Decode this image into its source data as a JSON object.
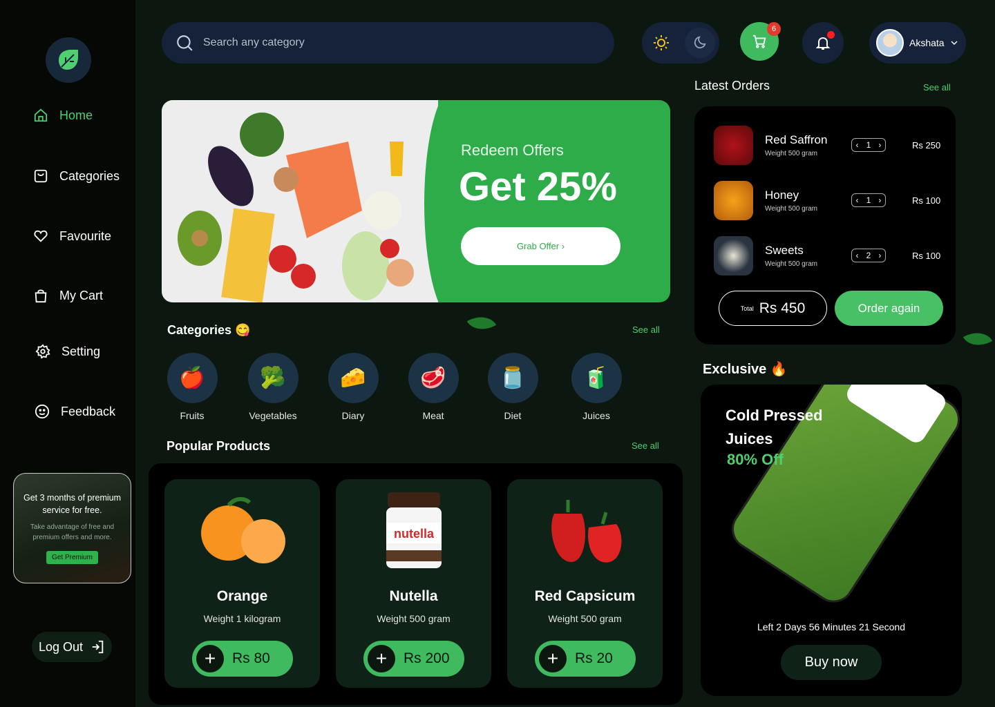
{
  "nav": {
    "items": [
      {
        "label": "Home",
        "icon": "home-icon"
      },
      {
        "label": "Categories",
        "icon": "categories-icon"
      },
      {
        "label": "Favourite",
        "icon": "heart-icon"
      },
      {
        "label": "My Cart",
        "icon": "shopping-bag-icon"
      },
      {
        "label": "Setting",
        "icon": "gear-icon"
      },
      {
        "label": "Feedback",
        "icon": "smiley-icon"
      }
    ],
    "active": "Home"
  },
  "premium": {
    "title": "Get 3 months of premium service for free.",
    "subtitle": "Take advantage of free and premium offers  and more.",
    "button": "Get Premium"
  },
  "logout": {
    "label": "Log Out"
  },
  "search": {
    "placeholder": "Search any category"
  },
  "header": {
    "cart_count": "6",
    "user_name": "Akshata"
  },
  "banner": {
    "subtitle": "Redeem Offers",
    "title": "Get 25%",
    "button": "Grab Offer ›"
  },
  "categories": {
    "title": "Categories 😋",
    "see_all": "See all",
    "items": [
      {
        "label": "Fruits",
        "emoji": "🍎"
      },
      {
        "label": "Vegetables",
        "emoji": "🥦"
      },
      {
        "label": "Diary",
        "emoji": "🧀"
      },
      {
        "label": "Meat",
        "emoji": "🥩"
      },
      {
        "label": "Diet",
        "emoji": "🫙"
      },
      {
        "label": "Juices",
        "emoji": "🧃"
      }
    ]
  },
  "popular": {
    "title": "Popular Products",
    "see_all": "See all",
    "products": [
      {
        "name": "Orange",
        "weight": "Weight 1 kilogram",
        "price": "Rs 80",
        "emoji": "🍊"
      },
      {
        "name": "Nutella",
        "weight": "Weight 500 gram",
        "price": "Rs 200",
        "emoji": "🫙"
      },
      {
        "name": "Red Capsicum",
        "weight": "Weight 500 gram",
        "price": "Rs 20",
        "emoji": "🫑"
      }
    ]
  },
  "orders": {
    "title": "Latest Orders",
    "see_all": "See all",
    "items": [
      {
        "name": "Red Saffron",
        "weight": "Weight 500 gram",
        "qty": "1",
        "price": "Rs 250"
      },
      {
        "name": "Honey",
        "weight": "Weight 500 gram",
        "qty": "1",
        "price": "Rs 100"
      },
      {
        "name": "Sweets",
        "weight": "Weight 500 gram",
        "qty": "2",
        "price": "Rs 100"
      }
    ],
    "total_label": "Total",
    "total_value": "Rs 450",
    "order_again": "Order again"
  },
  "exclusive": {
    "title": "Exclusive 🔥",
    "product_line1": "Cold Pressed",
    "product_line2": "Juices",
    "discount": "80% Off",
    "countdown": "Left 2 Days 56 Minutes 21 Second",
    "buy": "Buy now"
  },
  "colors": {
    "accent": "#3fba5e",
    "background": "#0b170f",
    "panel": "#000000",
    "input_bg": "#16223a"
  }
}
